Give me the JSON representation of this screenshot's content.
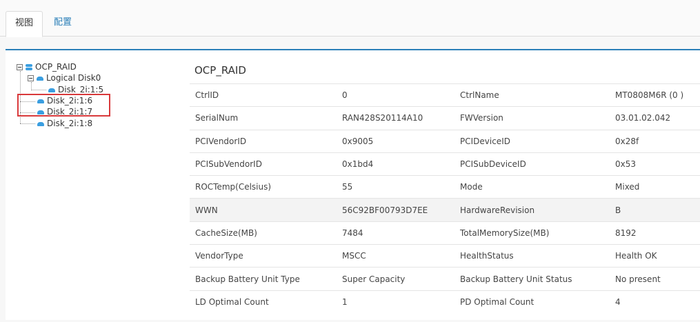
{
  "tabs": [
    {
      "label": "视图",
      "active": true
    },
    {
      "label": "配置",
      "active": false
    }
  ],
  "tree": {
    "root": "OCP_RAID",
    "logical": "Logical Disk0",
    "logical_child": "Disk_2i:1:5",
    "disks": [
      "Disk_2i:1:6",
      "Disk_2i:1:7",
      "Disk_2i:1:8"
    ]
  },
  "detail": {
    "title": "OCP_RAID",
    "rows": [
      [
        "CtrlID",
        "0",
        "CtrlName",
        "MT0808M6R (0 )"
      ],
      [
        "SerialNum",
        "RAN428S20114A10",
        "FWVersion",
        "03.01.02.042"
      ],
      [
        "PCIVendorID",
        "0x9005",
        "PCIDeviceID",
        "0x28f"
      ],
      [
        "PCISubVendorID",
        "0x1bd4",
        "PCISubDeviceID",
        "0x53"
      ],
      [
        "ROCTemp(Celsius)",
        "55",
        "Mode",
        "Mixed"
      ],
      [
        "WWN",
        "56C92BF00793D7EE",
        "HardwareRevision",
        "B"
      ],
      [
        "CacheSize(MB)",
        "7484",
        "TotalMemorySize(MB)",
        "8192"
      ],
      [
        "VendorType",
        "MSCC",
        "HealthStatus",
        "Health OK"
      ],
      [
        "Backup Battery Unit Type",
        "Super Capacity",
        "Backup Battery Unit Status",
        "No present"
      ],
      [
        "LD Optimal Count",
        "1",
        "PD Optimal Count",
        "4"
      ]
    ]
  },
  "colors": {
    "accent": "#2a7fb8",
    "highlight": "#d9393b",
    "icon": "#3a9ee0"
  }
}
